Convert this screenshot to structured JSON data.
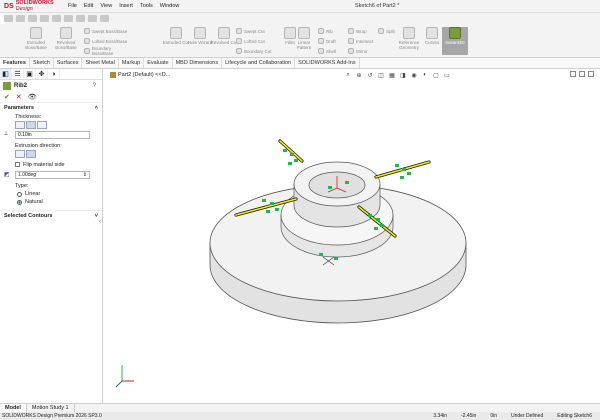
{
  "app": {
    "brand_prefix": "DS",
    "brand": "SOLIDWORKS",
    "brand_suffix": "Design",
    "doc_title": "Sketch6 of Part2 *"
  },
  "menu": [
    "File",
    "Edit",
    "View",
    "Insert",
    "Tools",
    "Window"
  ],
  "commands": {
    "extruded_boss": "Extruded Boss/Base",
    "revolved_boss": "Revolved Boss/Base",
    "swept_boss": "Swept Boss/Base",
    "lofted_boss": "Lofted Boss/Base",
    "boundary_boss": "Boundary Boss/Base",
    "extruded_cut": "Extruded Cut",
    "hole_wizard": "Hole Wizard",
    "revolved_cut": "Revolved Cut",
    "swept_cut": "Swept Cut",
    "lofted_cut": "Lofted Cut",
    "boundary_cut": "Boundary Cut",
    "fillet": "Fillet",
    "linear_pattern": "Linear Pattern",
    "rib": "Rib",
    "draft": "Draft",
    "shell": "Shell",
    "wrap": "Wrap",
    "intersect": "Intersect",
    "mirror": "Mirror",
    "split": "Split",
    "reference_geometry": "Reference Geometry",
    "curves": "Curves",
    "instant3d": "Instant3D"
  },
  "tabs": [
    "Features",
    "Sketch",
    "Surfaces",
    "Sheet Metal",
    "Markup",
    "Evaluate",
    "MBD Dimensions",
    "Lifecycle and Collaboration",
    "SOLIDWORKS Add-Ins"
  ],
  "property_manager": {
    "title": "Rib2",
    "parameters_label": "Parameters",
    "thickness_label": "Thickness:",
    "thickness_value": "0.10in",
    "extrusion_direction_label": "Extrusion direction:",
    "flip_label": "Flip material side",
    "draft_value": "1.00deg",
    "type_label": "Type:",
    "type_linear": "Linear",
    "type_natural": "Natural",
    "selected_contours_label": "Selected Contours"
  },
  "viewport": {
    "tree_label": "Part2 (Default) <<D..."
  },
  "bottom_tabs": [
    "Model",
    "Motion Study 1"
  ],
  "status": {
    "product": "SOLIDWORKS Design Premium 2026 SP3.0",
    "x": "3.34in",
    "y": "-2.45in",
    "z": "0in",
    "state": "Under Defined",
    "editing": "Editing Sketch6"
  },
  "colors": {
    "brand_red": "#c8102e",
    "sketch_yellow": "#f2ee1a",
    "relation_green": "#2bb14a",
    "origin_red": "#d21f1f"
  }
}
